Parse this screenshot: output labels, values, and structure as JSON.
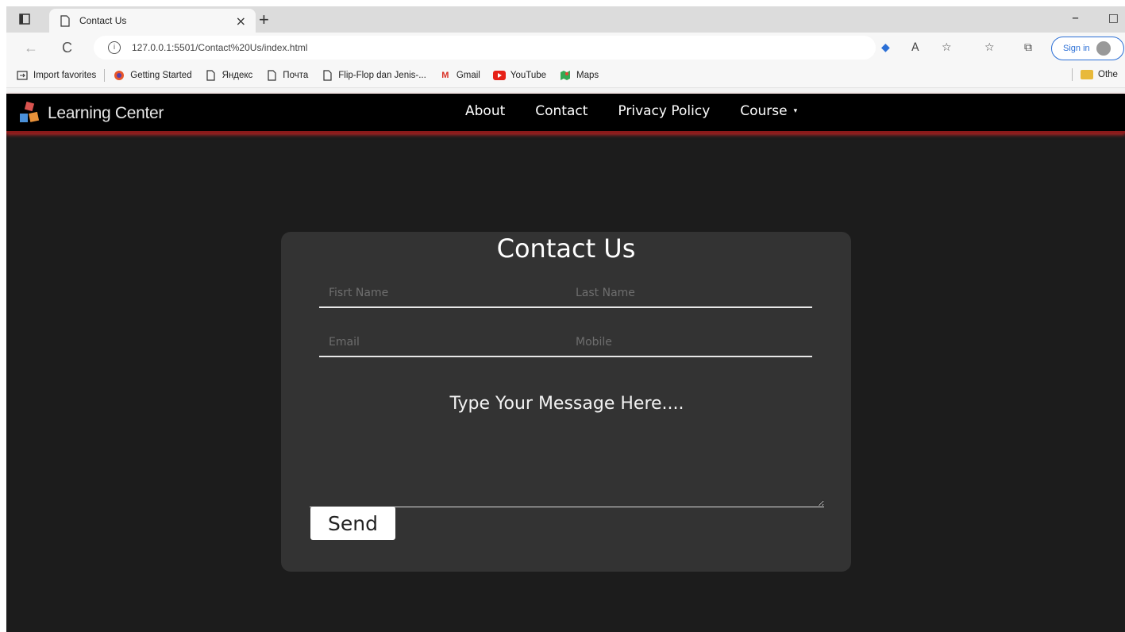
{
  "browser": {
    "tab_title": "Contact Us",
    "tab_close": "×",
    "new_tab": "+",
    "min_glyph": "–",
    "max_glyph": "□",
    "back_glyph": "←",
    "refresh_glyph": "C",
    "url": "127.0.0.1:5501/Contact%20Us/index.html",
    "signin_label": "Sign in"
  },
  "favorites": {
    "items": [
      {
        "label": "Import favorites",
        "icon": "import-icon"
      },
      {
        "label": "Getting Started",
        "icon": "firefox-icon"
      },
      {
        "label": "Яндекс",
        "icon": "page-icon"
      },
      {
        "label": "Почта",
        "icon": "page-icon"
      },
      {
        "label": "Flip-Flop dan Jenis-...",
        "icon": "page-icon"
      },
      {
        "label": "Gmail",
        "icon": "gmail-icon"
      },
      {
        "label": "YouTube",
        "icon": "youtube-icon"
      },
      {
        "label": "Maps",
        "icon": "maps-icon"
      }
    ],
    "other": "Othe"
  },
  "navbar": {
    "brand": "Learning Center",
    "links": {
      "about": "About",
      "contact": "Contact",
      "privacy": "Privacy Policy",
      "course": "Course"
    },
    "course_caret": "▾"
  },
  "form": {
    "title": "Contact Us",
    "first_name_placeholder": "Fisrt Name",
    "last_name_placeholder": "Last Name",
    "email_placeholder": "Email",
    "mobile_placeholder": "Mobile",
    "message_placeholder": "Type Your Message Here....",
    "send_label": "Send"
  },
  "colors": {
    "page_bg": "#1c1c1c",
    "card_bg": "#333333",
    "navbar_bg": "#000000",
    "navbar_accent": "#8a1a1a"
  }
}
